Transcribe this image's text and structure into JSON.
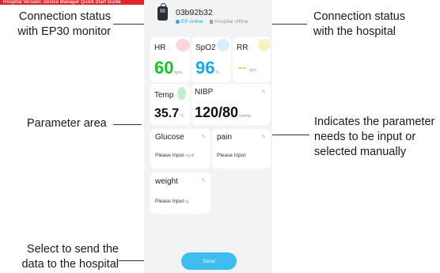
{
  "header_banner": "Hospital Version: Device Manager Quick Start Guide",
  "annotations": {
    "connection_ep30": "Connection status\nwith EP30 monitor",
    "connection_hospital": "Connection status\nwith the hospital",
    "parameter_area": "Parameter area",
    "manual_input": "Indicates the parameter\nneeds to be input or\nselected manually",
    "send_hint": "Select to send the\ndata to the hospital"
  },
  "device": {
    "id": "03b92b32",
    "ep_status": "EP online",
    "hospital_status": "Hospital offline"
  },
  "params": {
    "hr": {
      "label": "HR",
      "value": "60",
      "unit": "bpm"
    },
    "spo2": {
      "label": "SpO2",
      "value": "96",
      "unit": "%"
    },
    "rr": {
      "label": "RR",
      "value": "--",
      "unit": "rpm"
    },
    "temp": {
      "label": "Temp",
      "value": "35.7",
      "unit": "°C"
    },
    "nibp": {
      "label": "NIBP",
      "value": "120/80",
      "unit": "mmHg"
    },
    "glucose": {
      "label": "Glucose",
      "placeholder": "Please Input",
      "unit": "mg/dl"
    },
    "pain": {
      "label": "pain",
      "placeholder": "Please Input"
    },
    "weight": {
      "label": "weight",
      "placeholder": "Please Input",
      "unit": "kg"
    }
  },
  "send_label": "Send",
  "colors": {
    "hr": "#1dbf2a",
    "spo2": "#1aa9e6",
    "rr": "#c8dc1f",
    "accent": "#3fbdf0",
    "banner": "#e0262c"
  }
}
